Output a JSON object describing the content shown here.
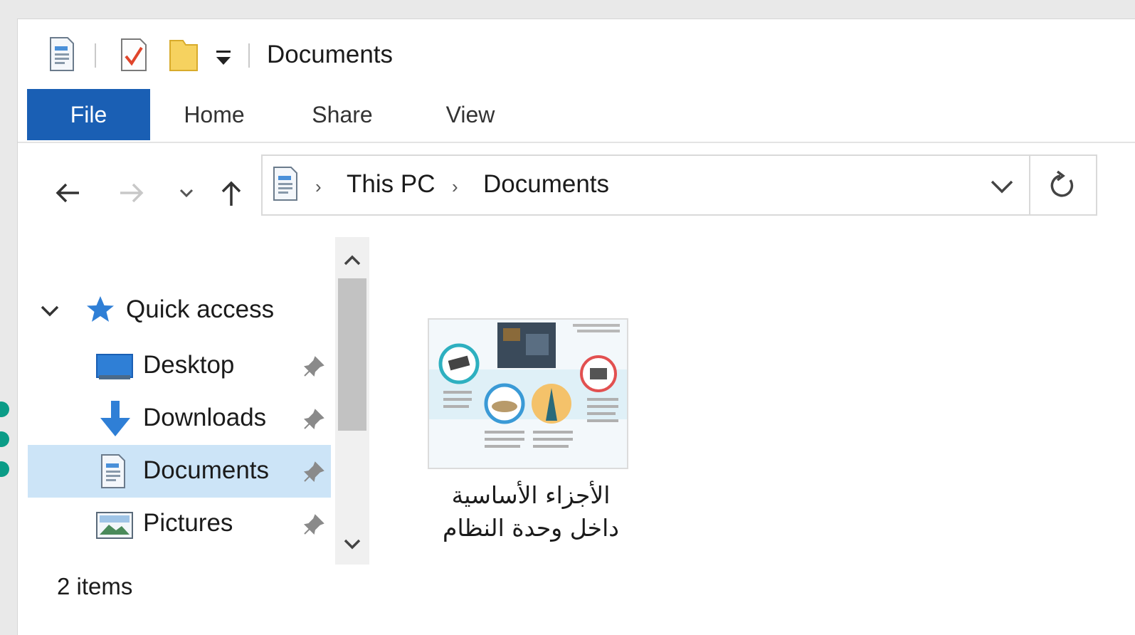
{
  "window": {
    "title": "Documents"
  },
  "ribbon": {
    "tabs": [
      {
        "label": "File",
        "active": true
      },
      {
        "label": "Home"
      },
      {
        "label": "Share"
      },
      {
        "label": "View"
      }
    ]
  },
  "toolbar": {
    "icons": [
      "properties-icon",
      "checklist-icon",
      "new-folder-icon",
      "customize-dropdown-icon"
    ],
    "nav": [
      "back-arrow-icon",
      "forward-arrow-icon",
      "recent-chevron-icon",
      "up-arrow-icon"
    ]
  },
  "address": {
    "crumbs": [
      "This PC",
      "Documents"
    ],
    "icons": [
      "documents-icon",
      "dropdown-chevron-icon",
      "refresh-icon"
    ]
  },
  "nav_pane": {
    "quick_access": {
      "label": "Quick access",
      "icon": "star-icon"
    },
    "items": [
      {
        "label": "Desktop",
        "icon": "desktop-icon",
        "pinned": true
      },
      {
        "label": "Downloads",
        "icon": "download-icon",
        "pinned": true
      },
      {
        "label": "Documents",
        "icon": "documents-icon",
        "pinned": true,
        "selected": true
      },
      {
        "label": "Pictures",
        "icon": "pictures-icon",
        "pinned": true
      }
    ]
  },
  "content": {
    "files": [
      {
        "line1": "الأجزاء الأساسية",
        "line2": "داخل وحدة النظام",
        "icon": "document-thumbnail-icon"
      }
    ]
  },
  "status_bar": {
    "count": "2 items"
  },
  "colors": {
    "accent": "#1a5fb4",
    "selection": "#cce4f7",
    "dots": "#0b9c87"
  }
}
